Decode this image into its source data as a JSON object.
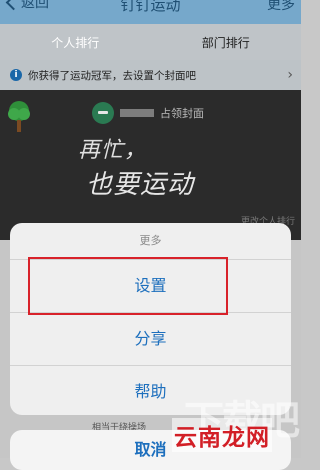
{
  "navbar": {
    "back_label": "返回",
    "title": "钉钉运动",
    "more_label": "更多"
  },
  "tabs": [
    {
      "label": "个人排行",
      "active": true
    },
    {
      "label": "部门排行",
      "active": false
    }
  ],
  "notice": {
    "text": "你获得了运动冠军，去设置个封面吧"
  },
  "cover": {
    "claim_label": "占领封面",
    "slogan_line1": "再忙，",
    "slogan_line2": "也要运动",
    "hint": "更改个人排行"
  },
  "behind_text": "相当于绕操场",
  "action_sheet": {
    "title": "更多",
    "items": [
      {
        "label": "设置"
      },
      {
        "label": "分享"
      },
      {
        "label": "帮助"
      }
    ],
    "cancel_label": "取消"
  },
  "watermark": {
    "brand_text": "下载吧",
    "red_text": "云南龙网"
  },
  "colors": {
    "link_blue": "#1d6fbd",
    "highlight_red": "#d8222a",
    "nav_bg": "#76a8cb"
  }
}
